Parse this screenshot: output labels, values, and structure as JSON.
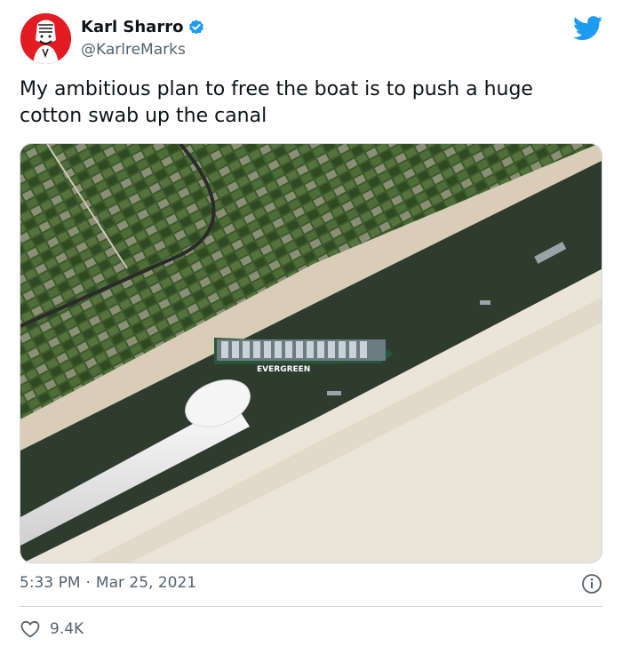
{
  "author": {
    "display_name": "Karl Sharro",
    "handle": "@KarlreMarks",
    "verified": true
  },
  "tweet": {
    "text": "My ambitious plan to free the boat is to push a huge cotton swab up the canal",
    "time": "5:33 PM",
    "separator": "·",
    "date": "Mar 25, 2021",
    "likes": "9.4K"
  },
  "media": {
    "ship_label": "EVERGREEN",
    "alt": "satellite photo of canal with ship and a giant cotton swab"
  },
  "icons": {
    "brand": "twitter-bird-icon",
    "verified": "verified-badge-icon",
    "info": "info-icon",
    "like": "heart-icon"
  },
  "colors": {
    "twitter_blue": "#1d9bf0",
    "text_primary": "#0f1419",
    "text_secondary": "#536471",
    "divider": "#cfd9de",
    "avatar_bg": "#e31b23"
  }
}
